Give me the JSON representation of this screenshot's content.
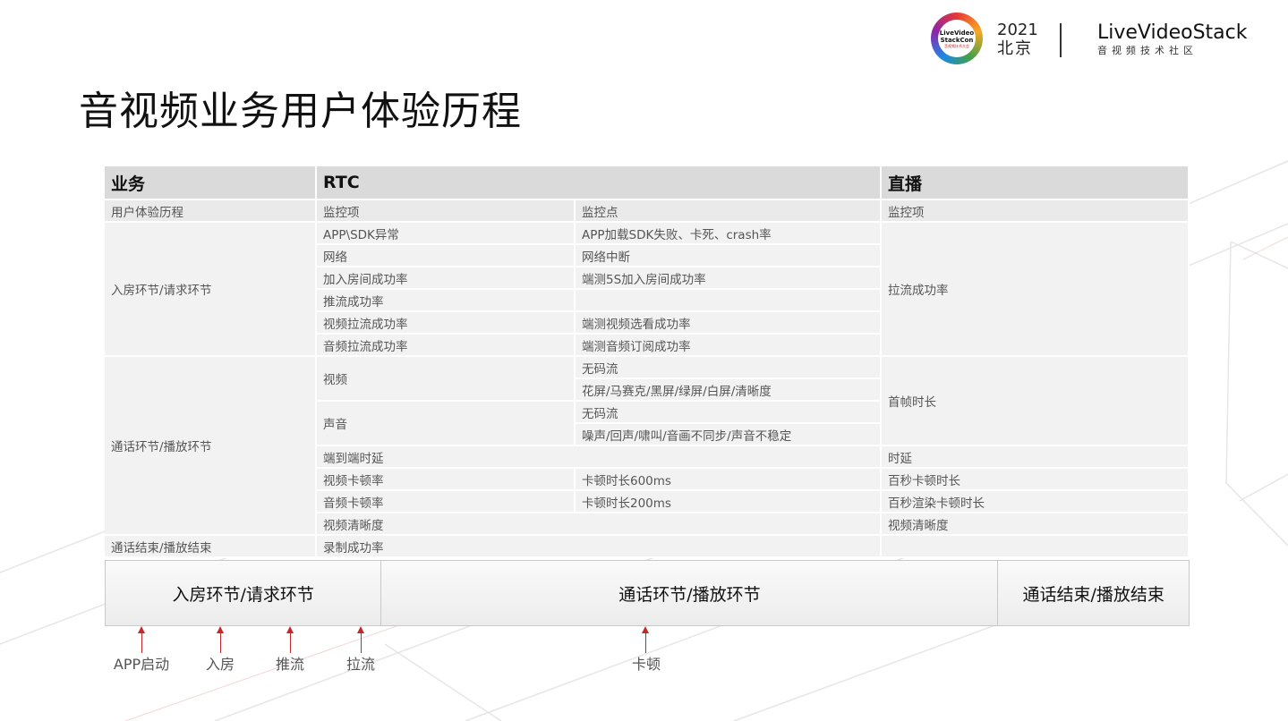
{
  "logo": {
    "ring_line1": "LiveVideo",
    "ring_line2": "StackCon",
    "ring_sub": "音视频技术大会",
    "year": "2021",
    "city": "北京",
    "brand": "LiveVideoStack",
    "brand_sub": "音视频技术社区"
  },
  "title": "音视频业务用户体验历程",
  "table": {
    "header": {
      "c1": "业务",
      "c2": "RTC",
      "c4": "直播"
    },
    "subheader": {
      "c1": "用户体验历程",
      "c2": "监控项",
      "c3": "监控点",
      "c4": "监控项"
    },
    "stage1": {
      "label": "入房环节/请求环节",
      "live": "拉流成功率",
      "rows": [
        {
          "item": "APP\\SDK异常",
          "point": "APP加载SDK失败、卡死、crash率"
        },
        {
          "item": "网络",
          "point": "网络中断"
        },
        {
          "item": "加入房间成功率",
          "point": "端测5S加入房间成功率"
        },
        {
          "item": "推流成功率",
          "point": ""
        },
        {
          "item": "视频拉流成功率",
          "point": "端测视频选看成功率"
        },
        {
          "item": "音频拉流成功率",
          "point": "端测音频订阅成功率"
        }
      ]
    },
    "stage2": {
      "label": "通话环节/播放环节",
      "video": {
        "item": "视频",
        "points": [
          "无码流",
          "花屏/马赛克/黑屏/绿屏/白屏/清晰度"
        ]
      },
      "audio": {
        "item": "声音",
        "points": [
          "无码流",
          "噪声/回声/啸叫/音画不同步/声音不稳定"
        ]
      },
      "first_frame": "首帧时长",
      "rows": [
        {
          "item": "端到端时延",
          "point": "",
          "live": "时延"
        },
        {
          "item": "视频卡顿率",
          "point": "卡顿时长600ms",
          "live": "百秒卡顿时长"
        },
        {
          "item": "音频卡顿率",
          "point": "卡顿时长200ms",
          "live": "百秒渲染卡顿时长"
        },
        {
          "item": "视频清晰度",
          "point": "",
          "live": "视频清晰度"
        }
      ]
    },
    "stage3": {
      "label": "通话结束/播放结束",
      "item": "录制成功率",
      "live": ""
    }
  },
  "flow": {
    "segments": [
      "入房环节/请求环节",
      "通话环节/播放环节",
      "通话结束/播放结束"
    ],
    "markers": [
      "APP启动",
      "入房",
      "推流",
      "拉流",
      "卡顿"
    ]
  },
  "colors": {
    "accent": "#c62828",
    "header_bg": "#dadada",
    "cell_bg": "#f2f2f2"
  }
}
